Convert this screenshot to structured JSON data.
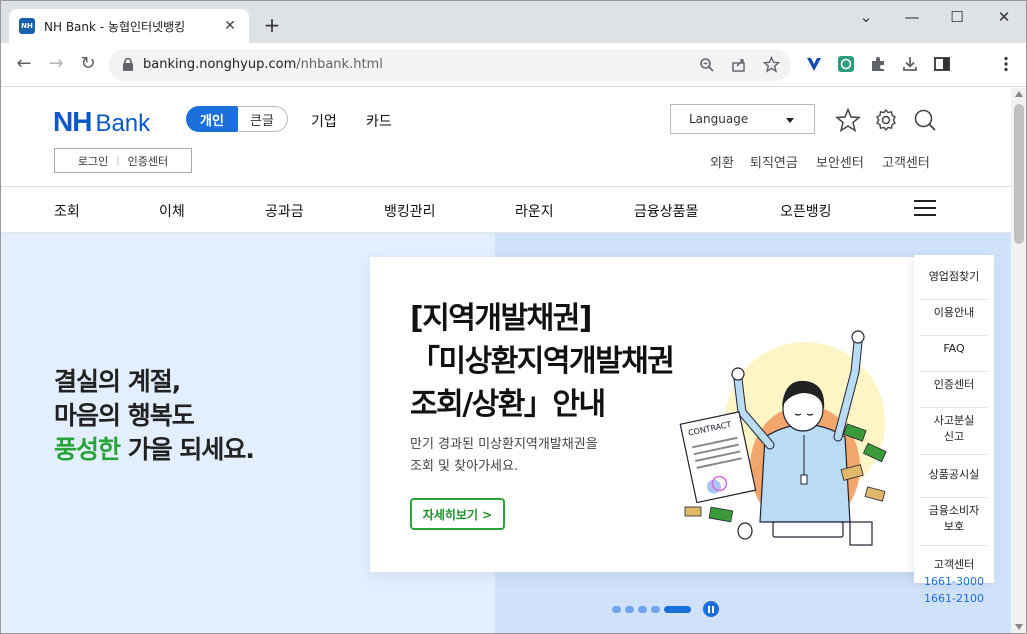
{
  "browser": {
    "tab_title": "NH Bank - 농협인터넷뱅킹",
    "favicon_text": "NH",
    "url_host": "banking.nonghyup.com",
    "url_path": "/nhbank.html",
    "new_tab": "+",
    "tab_close": "✕",
    "window": {
      "minimize": "—",
      "maximize": "☐",
      "close": "✕",
      "chevron": "⌄"
    },
    "nav": {
      "back": "←",
      "forward": "→",
      "reload": "↻"
    }
  },
  "header": {
    "logo_nh": "NH",
    "logo_bank": "Bank",
    "mode_personal": "개인",
    "mode_large": "큰글",
    "nav": {
      "corporate": "기업",
      "card": "카드"
    },
    "login": "로그인",
    "cert": "인증센터",
    "language": "Language",
    "utility": {
      "fx": "외환",
      "pension": "퇴직연금",
      "security": "보안센터",
      "customer": "고객센터"
    }
  },
  "gnb": [
    "조회",
    "이체",
    "공과금",
    "뱅킹관리",
    "라운지",
    "금융상품몰",
    "오픈뱅킹"
  ],
  "hero": {
    "slogan_line1": "결실의 계절,",
    "slogan_line2": "마음의 행복도",
    "slogan_green": "풍성한",
    "slogan_rest": " 가을 되세요.",
    "headline": "[지역개발채권]\n「미상환지역개발채권\n조회/상환」안내",
    "desc_line1": "만기 경과된 미상환지역개발채권을",
    "desc_line2": "조회 및 찾아가세요.",
    "detail_button": "자세히보기  >",
    "contract_label": "CONTRACT"
  },
  "quick_menu": {
    "branch": "영업점찾기",
    "guide": "이용안내",
    "faq": "FAQ",
    "cert": "인증센터",
    "accident_1": "사고분실",
    "accident_2": "신고",
    "disclosure": "상품공시실",
    "consumer_1": "금융소비자",
    "consumer_2": "보호",
    "customer": "고객센터",
    "tel1": "1661-3000",
    "tel2": "1661-2100"
  },
  "colors": {
    "brand_blue": "#0a58c7",
    "accent_blue": "#1a6fdb",
    "green": "#2aa43a"
  }
}
